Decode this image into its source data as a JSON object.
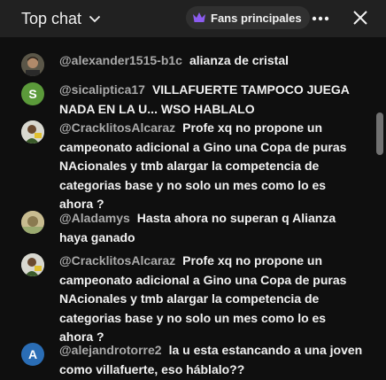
{
  "header": {
    "title": "Top chat",
    "fans_label": "Fans principales",
    "icons": [
      "chevron-down-icon",
      "crown-icon",
      "more-icon",
      "close-icon"
    ]
  },
  "messages": [
    {
      "author": "@alexander1515-b1c",
      "text": "alianza de cristal",
      "avatar": "photo",
      "avatar_color": "#4a4a3a"
    },
    {
      "author": "@sicaliptica17",
      "text": "VILLAFUERTE TAMPOCO JUEGA NADA EN LA U... WSO HABLALO",
      "avatar_letter": "S",
      "avatar_color": "#5b9a3a"
    },
    {
      "author": "@CracklitosAlcaraz",
      "text": "Profe xq no propone un campeonato adicional a Gino una Copa de puras NAcionales y tmb alargar la competencia de categorias base y no solo un mes como lo es ahora ?",
      "avatar": "photo",
      "avatar_color": "#d8d8d0"
    },
    {
      "author": "@Aladamys",
      "text": "Hasta ahora no superan q Alianza haya ganado",
      "avatar": "photo",
      "avatar_color": "#b8a97a"
    },
    {
      "author": "@CracklitosAlcaraz",
      "text": "Profe xq no propone un campeonato adicional a Gino una Copa de puras NAcionales y tmb alargar la competencia de categorias base y no solo un mes como lo es ahora ?",
      "avatar": "photo",
      "avatar_color": "#d8d8d0"
    },
    {
      "author": "@alejandrotorre2",
      "text": "la u esta estancando a una joven como villafuerte, eso háblalo??",
      "avatar_letter": "A",
      "avatar_color": "#2a6db5"
    }
  ],
  "colors": {
    "background": "#0f0f0f",
    "header": "#212121",
    "author": "#aaaaaa",
    "crown": "#8c5cf0"
  }
}
